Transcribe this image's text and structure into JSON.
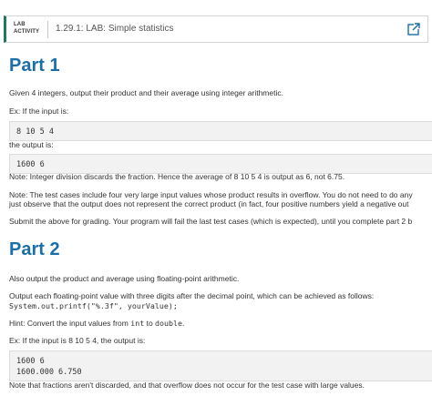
{
  "header": {
    "badge_line1": "LAB",
    "badge_line2": "ACTIVITY",
    "title": "1.29.1: LAB: Simple statistics",
    "open_icon": "open-external-icon",
    "accent_color": "#1d7a5f"
  },
  "part1": {
    "heading": "Part 1",
    "intro": "Given 4 integers, output their product and their average using integer arithmetic.",
    "ex_label": "Ex: If the input is:",
    "input_example": "8 10 5 4",
    "output_label": "the output is:",
    "output_example": "1600 6",
    "note1": "Note: Integer division discards the fraction. Hence the average of 8 10 5 4 is output as 6, not 6.75.",
    "note2_line1": "Note: The test cases include four very large input values whose product results in overflow. You do not need to do any",
    "note2_line2": "just observe that the output does not represent the correct product (in fact, four positive numbers yield a negative out",
    "submit": "Submit the above for grading. Your program will fail the last test cases (which is expected), until you complete part 2 b"
  },
  "part2": {
    "heading": "Part 2",
    "intro": "Also output the product and average using floating-point arithmetic.",
    "format_text": "Output each floating-point value with three digits after the decimal point, which can be achieved as follows:",
    "format_code": "System.out.printf(\"%.3f\", yourValue);",
    "hint_pre": "Hint: Convert the input values from ",
    "hint_code1": "int",
    "hint_mid": " to ",
    "hint_code2": "double",
    "hint_post": ".",
    "ex_label": "Ex: If the input is 8 10 5 4, the output is:",
    "output_line1": "1600 6",
    "output_line2": "1600.000 6.750",
    "note": "Note that fractions aren't discarded, and that overflow does not occur for the test case with large values."
  }
}
